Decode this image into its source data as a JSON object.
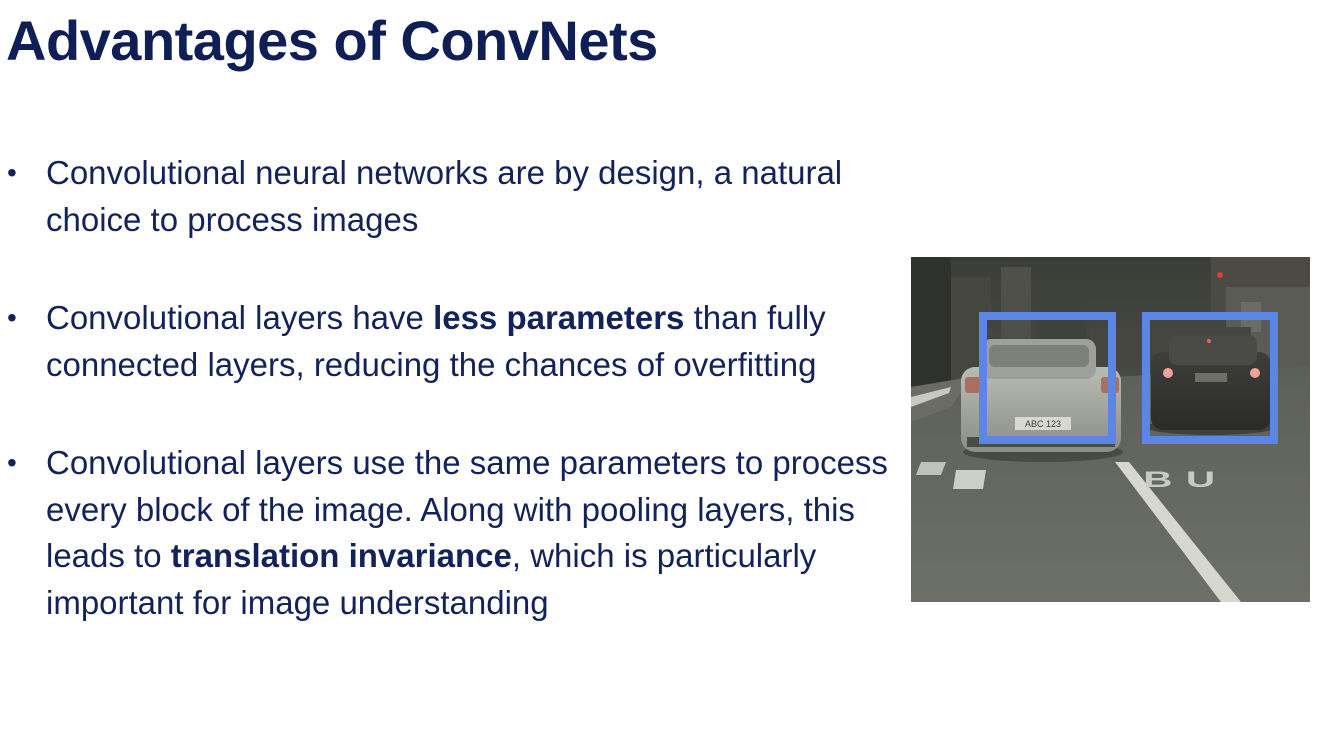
{
  "slide": {
    "title": "Advantages of ConvNets",
    "bullets": [
      {
        "text": "Convolutional neural networks are by design, a natural choice to process images"
      },
      {
        "before": "Convolutional layers have ",
        "bold": "less parameters",
        "after": " than fully connected layers, reducing the chances of overfitting"
      },
      {
        "before": "Convolutional layers use the same parameters to process every block of the image. Along with pooling layers, this leads to ",
        "bold": "translation invariance",
        "after": ", which is particularly important for image understanding"
      }
    ],
    "image": {
      "road_marking": "BU",
      "plate_text": "ABC 123",
      "box_color": "#5b86e6",
      "bounding_box_count": 2
    }
  },
  "colors": {
    "title": "#0f1f56",
    "body_text": "#14225a",
    "background": "#ffffff"
  }
}
